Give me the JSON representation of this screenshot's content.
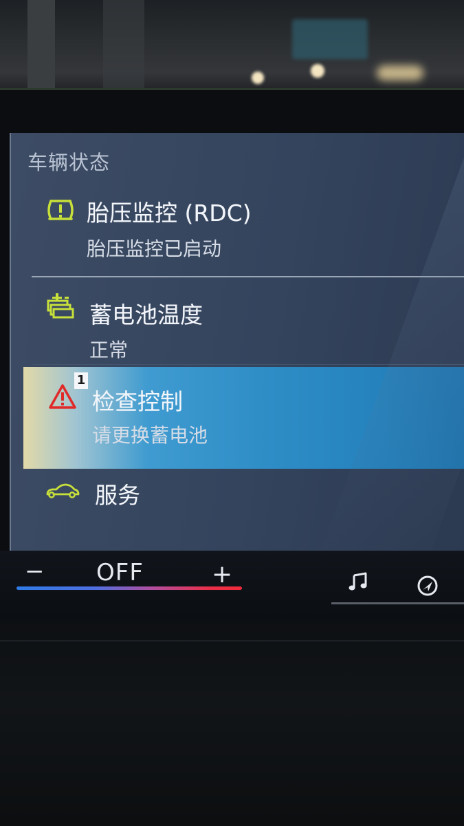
{
  "menu": {
    "title": "车辆状态",
    "items": [
      {
        "icon": "tire-pressure-warning-icon",
        "title": "胎压监控 (RDC)",
        "subtitle": "胎压监控已启动",
        "icon_color": "#c8e03a"
      },
      {
        "icon": "battery-temperature-icon",
        "title": "蓄电池温度",
        "subtitle": "正常",
        "icon_color": "#c8e03a"
      },
      {
        "icon": "warning-triangle-icon",
        "title": "检查控制",
        "subtitle": "请更换蓄电池",
        "badge": "1",
        "icon_color": "#e02a2a",
        "selected": true
      },
      {
        "icon": "car-icon",
        "title": "服务",
        "icon_color": "#c8e03a"
      }
    ]
  },
  "climate": {
    "minus": "−",
    "value": "OFF",
    "plus": "+"
  },
  "colors": {
    "panel": "#3a4962",
    "highlight": "#2f8dc6",
    "indicator": "#c8e03a",
    "warning": "#e02a2a"
  }
}
